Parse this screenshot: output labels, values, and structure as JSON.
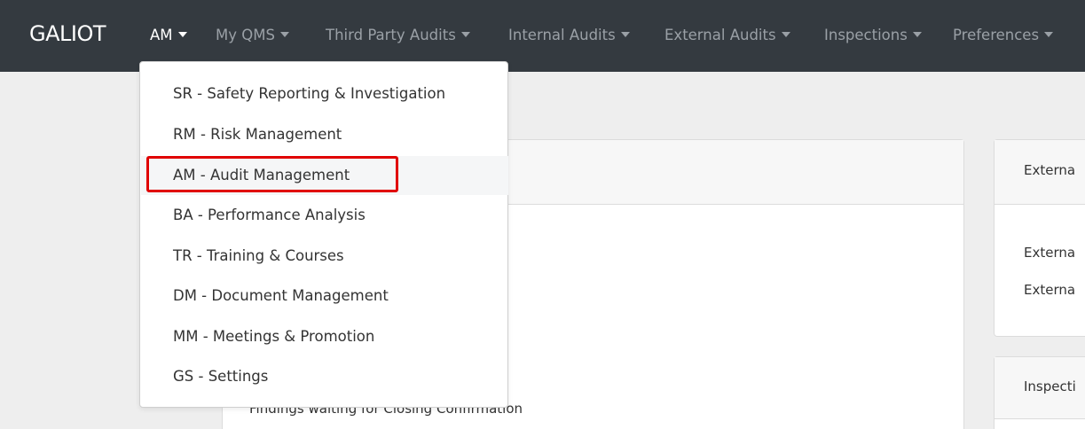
{
  "navbar": {
    "brand": "GALIOT",
    "items": [
      {
        "label": "AM",
        "active": true
      },
      {
        "label": "My QMS",
        "active": false
      },
      {
        "label": "Third Party Audits",
        "active": false
      },
      {
        "label": "Internal Audits",
        "active": false
      },
      {
        "label": "External Audits",
        "active": false
      },
      {
        "label": "Inspections",
        "active": false
      },
      {
        "label": "Preferences",
        "active": false
      }
    ]
  },
  "dropdown": {
    "items": [
      {
        "label": "SR - Safety Reporting & Investigation"
      },
      {
        "label": "RM - Risk Management"
      },
      {
        "label": "AM - Audit Management",
        "highlighted": true
      },
      {
        "label": "BA - Performance Analysis"
      },
      {
        "label": "TR - Training & Courses"
      },
      {
        "label": "DM - Document Management"
      },
      {
        "label": "MM - Meetings & Promotion"
      },
      {
        "label": "GS - Settings"
      }
    ]
  },
  "main_card": {
    "text_partial": "Findings waiting for Closing Confirmation"
  },
  "right_cards": {
    "external_header": "Externa",
    "external_line_1": "Externa",
    "external_line_2": "Externa",
    "inspection_header": "Inspecti"
  },
  "colors": {
    "navbar_bg": "#343a40",
    "highlight_border": "#e00000",
    "page_bg": "#eeeeee"
  }
}
